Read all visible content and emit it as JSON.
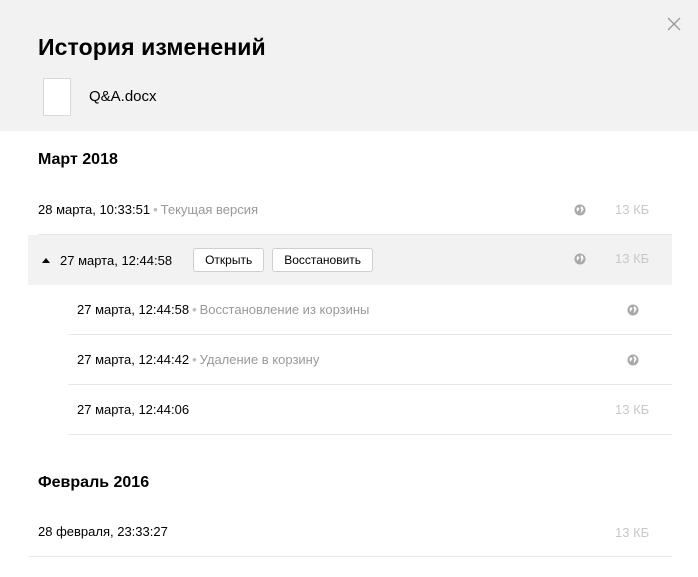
{
  "dialog": {
    "title": "История изменений",
    "file_name": "Q&A.docx"
  },
  "groups": [
    {
      "title": "Март 2018",
      "rows": [
        {
          "date": "28 марта, 10:33:51",
          "separator": "•",
          "note": "Текущая версия",
          "has_globe": true,
          "size": "13 КБ"
        },
        {
          "date": "27 марта, 12:44:58",
          "has_globe": true,
          "size": "13 КБ",
          "expanded": true,
          "open_label": "Открыть",
          "restore_label": "Восстановить",
          "children": [
            {
              "date": "27 марта, 12:44:58",
              "separator": "•",
              "note": "Восстановление из корзины",
              "has_globe": true
            },
            {
              "date": "27 марта, 12:44:42",
              "separator": "•",
              "note": "Удаление в корзину",
              "has_globe": true
            },
            {
              "date": "27 марта, 12:44:06",
              "size": "13 КБ"
            }
          ]
        }
      ]
    },
    {
      "title": "Февраль 2016",
      "rows": [
        {
          "date": "28 февраля, 23:33:27",
          "size": "13 КБ"
        }
      ]
    }
  ],
  "icons": {
    "close": "close-icon",
    "file": "document-icon",
    "globe": "globe-icon",
    "caret": "caret-up-icon"
  },
  "colors": {
    "header_bg": "#f2f2f2",
    "expanded_bg": "#f2f2f2",
    "note_text": "#999999",
    "size_text": "#c8c8c8"
  }
}
